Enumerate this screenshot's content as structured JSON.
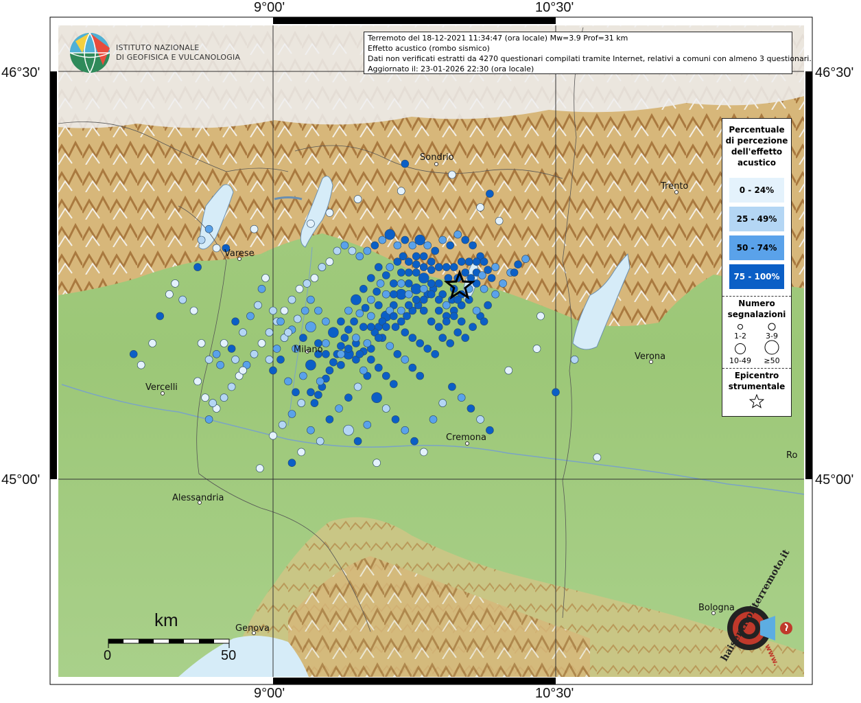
{
  "title_box": {
    "line1": "Terremoto del 18-12-2021 11:34:47 (ora locale) Mw=3.9 Prof=31 km",
    "line2": "Effetto acustico (rombo sismico)",
    "line3": "Dati non verificati estratti da 4270 questionari compilati tramite Internet, relativi a comuni con almeno 3 questionari.",
    "line4": "Aggiornato il: 23-01-2026 22:30 (ora locale)"
  },
  "logo": {
    "line1": "ISTITUTO NAZIONALE",
    "line2": "DI GEOFISICA E VULCANOLOGIA"
  },
  "coords": {
    "lon_left": "9°00'",
    "lon_right": "10°30'",
    "lat_top": "46°30'",
    "lat_bottom": "45°00'"
  },
  "legend": {
    "title": [
      "Percentuale",
      "di percezione",
      "dell'effetto",
      "acustico"
    ],
    "classes": [
      {
        "label": "0 - 24%",
        "color": "#e4f2fc"
      },
      {
        "label": "25 - 49%",
        "color": "#b4d6f4"
      },
      {
        "label": "50 - 74%",
        "color": "#5aa2ea"
      },
      {
        "label": "75 - 100%",
        "color": "#0b5fc6"
      }
    ],
    "count_title": [
      "Numero",
      "segnalazioni"
    ],
    "count_sizes": [
      "1-2",
      "3-9",
      "10-49",
      "≥50"
    ],
    "epicenter_title": [
      "Epicentro",
      "strumentale"
    ]
  },
  "cities": [
    "Sondrio",
    "Trento",
    "Varese",
    "Milano",
    "Verona",
    "Vercelli",
    "Cremona",
    "Alessandria",
    "Genova",
    "Bologna",
    "Ro"
  ],
  "scale": {
    "unit": "km",
    "zero": "0",
    "max": "50"
  },
  "watermark": {
    "text": "haisentitoilterremoto.it",
    "prefix": "www."
  },
  "colors": {
    "c1": "#e4f2fc",
    "c2": "#b4d6f4",
    "c3": "#5aa2ea",
    "c4": "#0b5fc6",
    "plain": "#9fc97c",
    "hills": "#d9b872",
    "mountains": "#b98a4f",
    "snow": "#f2f2f2",
    "water": "#d6ecf8"
  },
  "epicenter": {
    "lon": 9.99,
    "lat": 45.71
  },
  "map_extent": {
    "lon": [
      8.2,
      11.1
    ],
    "lat": [
      44.28,
      46.68
    ]
  },
  "points": [
    [
      9.93,
      45.74,
      4,
      2
    ],
    [
      9.88,
      45.72,
      4,
      2
    ],
    [
      9.85,
      45.7,
      4,
      2
    ],
    [
      9.82,
      45.68,
      4,
      2
    ],
    [
      9.8,
      45.66,
      4,
      2
    ],
    [
      9.77,
      45.64,
      4,
      2
    ],
    [
      9.74,
      45.62,
      4,
      2
    ],
    [
      9.71,
      45.6,
      4,
      2
    ],
    [
      9.68,
      45.58,
      4,
      2
    ],
    [
      9.65,
      45.56,
      4,
      2
    ],
    [
      9.9,
      45.68,
      4,
      2
    ],
    [
      9.95,
      45.66,
      4,
      2
    ],
    [
      9.98,
      45.74,
      4,
      2
    ],
    [
      10.02,
      45.76,
      4,
      2
    ],
    [
      10.05,
      45.74,
      4,
      2
    ],
    [
      10.08,
      45.76,
      4,
      2
    ],
    [
      10.11,
      45.75,
      3,
      2
    ],
    [
      10.14,
      45.77,
      4,
      2
    ],
    [
      9.96,
      45.78,
      4,
      2
    ],
    [
      9.92,
      45.78,
      4,
      2
    ],
    [
      9.88,
      45.78,
      4,
      2
    ],
    [
      9.84,
      45.77,
      4,
      2
    ],
    [
      9.8,
      45.78,
      4,
      2
    ],
    [
      9.76,
      45.79,
      4,
      2
    ],
    [
      9.72,
      45.8,
      4,
      2
    ],
    [
      9.69,
      45.82,
      4,
      2
    ],
    [
      9.66,
      45.8,
      4,
      2
    ],
    [
      9.62,
      45.78,
      3,
      2
    ],
    [
      9.6,
      45.75,
      4,
      2
    ],
    [
      9.57,
      45.72,
      3,
      2
    ],
    [
      9.55,
      45.69,
      4,
      2
    ],
    [
      9.52,
      45.66,
      3,
      2
    ],
    [
      9.49,
      45.63,
      4,
      2
    ],
    [
      9.46,
      45.61,
      3,
      2
    ],
    [
      9.43,
      45.58,
      4,
      2
    ],
    [
      9.4,
      45.55,
      4,
      2
    ],
    [
      9.38,
      45.52,
      4,
      2
    ],
    [
      9.36,
      45.49,
      4,
      2
    ],
    [
      9.34,
      45.46,
      4,
      2
    ],
    [
      9.32,
      45.43,
      4,
      2
    ],
    [
      9.3,
      45.4,
      4,
      2
    ],
    [
      9.28,
      45.37,
      4,
      2
    ],
    [
      9.26,
      45.34,
      4,
      2
    ],
    [
      9.24,
      45.31,
      4,
      2
    ],
    [
      9.22,
      45.28,
      4,
      2
    ],
    [
      9.28,
      45.58,
      3,
      2
    ],
    [
      9.24,
      45.62,
      3,
      2
    ],
    [
      9.2,
      45.66,
      3,
      2
    ],
    [
      9.17,
      45.62,
      3,
      2
    ],
    [
      9.13,
      45.59,
      2,
      2
    ],
    [
      9.1,
      45.55,
      3,
      2
    ],
    [
      9.06,
      45.52,
      2,
      2
    ],
    [
      9.02,
      45.48,
      3,
      2
    ],
    [
      8.98,
      45.44,
      2,
      2
    ],
    [
      9.44,
      45.5,
      4,
      2
    ],
    [
      9.48,
      45.47,
      4,
      2
    ],
    [
      9.52,
      45.44,
      4,
      2
    ],
    [
      9.56,
      45.41,
      4,
      2
    ],
    [
      9.6,
      45.38,
      4,
      2
    ],
    [
      9.64,
      45.35,
      4,
      2
    ],
    [
      9.58,
      45.52,
      4,
      2
    ],
    [
      9.62,
      45.49,
      3,
      2
    ],
    [
      9.66,
      45.46,
      4,
      2
    ],
    [
      9.7,
      45.44,
      3,
      2
    ],
    [
      9.74,
      45.41,
      4,
      2
    ],
    [
      9.78,
      45.38,
      4,
      2
    ],
    [
      9.7,
      45.54,
      4,
      2
    ],
    [
      9.74,
      45.52,
      4,
      2
    ],
    [
      9.78,
      45.5,
      4,
      2
    ],
    [
      9.82,
      45.48,
      4,
      2
    ],
    [
      9.86,
      45.46,
      4,
      2
    ],
    [
      9.9,
      45.52,
      4,
      2
    ],
    [
      9.94,
      45.5,
      4,
      2
    ],
    [
      9.98,
      45.54,
      4,
      2
    ],
    [
      10.02,
      45.52,
      4,
      2
    ],
    [
      10.06,
      45.56,
      4,
      2
    ],
    [
      10.1,
      45.6,
      4,
      2
    ],
    [
      10.14,
      45.64,
      4,
      2
    ],
    [
      10.18,
      45.68,
      3,
      2
    ],
    [
      10.22,
      45.72,
      3,
      2
    ],
    [
      10.26,
      45.76,
      3,
      2
    ],
    [
      10.3,
      45.79,
      4,
      2
    ],
    [
      10.34,
      45.81,
      3,
      2
    ],
    [
      10.1,
      45.82,
      4,
      2
    ],
    [
      10.06,
      45.86,
      4,
      2
    ],
    [
      10.02,
      45.88,
      4,
      2
    ],
    [
      9.98,
      45.9,
      3,
      2
    ],
    [
      9.94,
      45.86,
      4,
      2
    ],
    [
      9.9,
      45.88,
      3,
      2
    ],
    [
      9.86,
      45.84,
      4,
      2
    ],
    [
      9.82,
      45.86,
      3,
      2
    ],
    [
      9.78,
      45.88,
      4,
      3
    ],
    [
      9.74,
      45.86,
      3,
      2
    ],
    [
      9.7,
      45.88,
      4,
      2
    ],
    [
      9.66,
      45.86,
      3,
      2
    ],
    [
      9.62,
      45.9,
      4,
      3
    ],
    [
      9.58,
      45.88,
      3,
      2
    ],
    [
      9.54,
      45.86,
      4,
      2
    ],
    [
      9.5,
      45.84,
      3,
      2
    ],
    [
      9.46,
      45.82,
      3,
      2
    ],
    [
      9.42,
      45.84,
      2,
      2
    ],
    [
      9.38,
      45.86,
      3,
      2
    ],
    [
      9.34,
      45.84,
      2,
      2
    ],
    [
      9.3,
      45.8,
      1,
      2
    ],
    [
      9.26,
      45.78,
      2,
      2
    ],
    [
      9.22,
      45.74,
      1,
      2
    ],
    [
      9.18,
      45.72,
      2,
      2
    ],
    [
      9.14,
      45.7,
      1,
      2
    ],
    [
      9.1,
      45.66,
      2,
      2
    ],
    [
      9.06,
      45.62,
      1,
      2
    ],
    [
      9.02,
      45.58,
      2,
      2
    ],
    [
      8.98,
      45.54,
      2,
      2
    ],
    [
      8.94,
      45.5,
      1,
      2
    ],
    [
      8.9,
      45.46,
      2,
      2
    ],
    [
      8.86,
      45.42,
      3,
      2
    ],
    [
      8.82,
      45.38,
      1,
      2
    ],
    [
      8.78,
      45.34,
      2,
      2
    ],
    [
      8.74,
      45.3,
      2,
      2
    ],
    [
      8.7,
      45.26,
      1,
      2
    ],
    [
      8.66,
      45.22,
      3,
      2
    ],
    [
      9.0,
      45.16,
      1,
      2
    ],
    [
      9.05,
      45.2,
      2,
      2
    ],
    [
      9.1,
      45.24,
      3,
      2
    ],
    [
      9.15,
      45.28,
      2,
      2
    ],
    [
      9.2,
      45.32,
      4,
      2
    ],
    [
      9.25,
      45.36,
      3,
      2
    ],
    [
      9.3,
      45.22,
      4,
      2
    ],
    [
      9.35,
      45.26,
      3,
      2
    ],
    [
      9.4,
      45.3,
      4,
      2
    ],
    [
      9.45,
      45.34,
      2,
      2
    ],
    [
      9.5,
      45.38,
      4,
      2
    ],
    [
      9.55,
      45.3,
      4,
      3
    ],
    [
      9.6,
      45.26,
      2,
      2
    ],
    [
      9.65,
      45.22,
      4,
      2
    ],
    [
      9.7,
      45.18,
      3,
      2
    ],
    [
      9.75,
      45.14,
      4,
      2
    ],
    [
      9.8,
      45.1,
      1,
      2
    ],
    [
      9.85,
      45.22,
      3,
      2
    ],
    [
      9.9,
      45.28,
      2,
      2
    ],
    [
      9.95,
      45.34,
      4,
      2
    ],
    [
      10.0,
      45.3,
      3,
      2
    ],
    [
      10.05,
      45.26,
      4,
      2
    ],
    [
      10.1,
      45.22,
      2,
      2
    ],
    [
      10.15,
      45.18,
      4,
      2
    ],
    [
      9.4,
      45.18,
      2,
      3
    ],
    [
      9.45,
      45.14,
      4,
      2
    ],
    [
      9.5,
      45.2,
      3,
      2
    ],
    [
      9.2,
      45.18,
      3,
      2
    ],
    [
      9.25,
      45.14,
      2,
      2
    ],
    [
      9.15,
      45.1,
      1,
      2
    ],
    [
      8.93,
      45.04,
      1,
      2
    ],
    [
      9.1,
      45.06,
      4,
      2
    ],
    [
      9.55,
      45.06,
      1,
      2
    ],
    [
      10.42,
      45.6,
      1,
      2
    ],
    [
      10.4,
      45.48,
      1,
      2
    ],
    [
      10.25,
      45.4,
      1,
      2
    ],
    [
      10.5,
      45.32,
      4,
      2
    ],
    [
      10.6,
      45.44,
      2,
      2
    ],
    [
      10.72,
      45.08,
      1,
      2
    ],
    [
      10.28,
      45.76,
      4,
      2
    ],
    [
      10.2,
      45.95,
      1,
      2
    ],
    [
      10.1,
      46.0,
      1,
      2
    ],
    [
      10.15,
      46.05,
      4,
      2
    ],
    [
      9.7,
      46.16,
      4,
      2
    ],
    [
      9.95,
      46.12,
      1,
      2
    ],
    [
      9.68,
      46.06,
      1,
      2
    ],
    [
      9.45,
      46.03,
      1,
      2
    ],
    [
      9.3,
      45.98,
      1,
      2
    ],
    [
      9.2,
      45.94,
      1,
      2
    ],
    [
      8.9,
      45.92,
      1,
      2
    ],
    [
      8.75,
      45.85,
      4,
      2
    ],
    [
      8.6,
      45.78,
      4,
      2
    ],
    [
      8.48,
      45.72,
      1,
      2
    ],
    [
      8.45,
      45.68,
      1,
      2
    ],
    [
      8.4,
      45.6,
      4,
      2
    ],
    [
      8.36,
      45.5,
      1,
      2
    ],
    [
      8.3,
      45.42,
      1,
      2
    ],
    [
      8.26,
      45.46,
      4,
      2
    ],
    [
      8.62,
      45.88,
      2,
      2
    ],
    [
      8.66,
      45.92,
      3,
      2
    ],
    [
      8.7,
      45.85,
      1,
      2
    ],
    [
      8.58,
      45.62,
      1,
      2
    ],
    [
      8.52,
      45.66,
      2,
      2
    ],
    [
      8.8,
      45.58,
      4,
      2
    ],
    [
      8.84,
      45.54,
      2,
      2
    ],
    [
      8.88,
      45.6,
      3,
      2
    ],
    [
      8.92,
      45.64,
      2,
      2
    ],
    [
      8.94,
      45.7,
      3,
      2
    ],
    [
      8.96,
      45.74,
      1,
      2
    ],
    [
      8.74,
      45.5,
      1,
      2
    ],
    [
      8.78,
      45.48,
      4,
      2
    ],
    [
      8.7,
      45.46,
      3,
      2
    ],
    [
      8.62,
      45.5,
      1,
      2
    ],
    [
      8.66,
      45.44,
      2,
      2
    ],
    [
      8.72,
      45.42,
      3,
      2
    ],
    [
      8.8,
      45.44,
      2,
      2
    ],
    [
      8.84,
      45.4,
      1,
      2
    ],
    [
      8.6,
      45.36,
      1,
      2
    ],
    [
      8.64,
      45.3,
      1,
      2
    ],
    [
      8.68,
      45.28,
      2,
      2
    ],
    [
      9.0,
      45.4,
      4,
      2
    ],
    [
      9.04,
      45.44,
      4,
      2
    ],
    [
      9.08,
      45.36,
      3,
      2
    ],
    [
      9.12,
      45.32,
      4,
      2
    ],
    [
      9.16,
      45.38,
      3,
      2
    ],
    [
      9.2,
      45.42,
      4,
      3
    ],
    [
      9.24,
      45.46,
      4,
      2
    ],
    [
      9.28,
      45.5,
      3,
      2
    ],
    [
      9.32,
      45.54,
      4,
      3
    ],
    [
      9.36,
      45.58,
      4,
      2
    ],
    [
      9.4,
      45.62,
      3,
      2
    ],
    [
      9.44,
      45.66,
      4,
      3
    ],
    [
      9.48,
      45.7,
      4,
      2
    ],
    [
      9.52,
      45.74,
      4,
      2
    ],
    [
      9.56,
      45.78,
      4,
      2
    ],
    [
      9.12,
      45.48,
      3,
      2
    ],
    [
      9.16,
      45.52,
      4,
      2
    ],
    [
      9.2,
      45.56,
      3,
      3
    ],
    [
      9.24,
      45.5,
      4,
      2
    ],
    [
      9.28,
      45.46,
      4,
      2
    ],
    [
      9.08,
      45.54,
      2,
      2
    ],
    [
      9.04,
      45.58,
      3,
      2
    ],
    [
      9.0,
      45.62,
      2,
      2
    ],
    [
      9.36,
      45.42,
      4,
      2
    ],
    [
      9.4,
      45.46,
      4,
      3
    ],
    [
      9.44,
      45.44,
      4,
      2
    ],
    [
      9.48,
      45.4,
      3,
      2
    ],
    [
      9.52,
      45.48,
      4,
      2
    ],
    [
      9.56,
      45.56,
      4,
      2
    ],
    [
      9.6,
      45.6,
      4,
      3
    ],
    [
      9.64,
      45.64,
      4,
      2
    ],
    [
      9.68,
      45.68,
      4,
      3
    ],
    [
      9.72,
      45.72,
      4,
      2
    ],
    [
      9.76,
      45.76,
      4,
      2
    ],
    [
      9.8,
      45.74,
      4,
      3
    ],
    [
      9.84,
      45.72,
      4,
      2
    ],
    [
      9.88,
      45.62,
      4,
      2
    ],
    [
      9.92,
      45.6,
      4,
      2
    ],
    [
      9.96,
      45.62,
      4,
      2
    ],
    [
      10.0,
      45.64,
      4,
      2
    ],
    [
      9.6,
      45.68,
      3,
      2
    ],
    [
      9.64,
      45.72,
      4,
      2
    ],
    [
      9.68,
      45.76,
      4,
      2
    ],
    [
      9.72,
      45.68,
      3,
      2
    ],
    [
      9.76,
      45.7,
      4,
      3
    ],
    [
      9.8,
      45.62,
      4,
      2
    ],
    [
      9.84,
      45.58,
      4,
      2
    ],
    [
      9.88,
      45.56,
      4,
      2
    ],
    [
      9.92,
      45.58,
      4,
      2
    ],
    [
      9.96,
      45.7,
      4,
      2
    ],
    [
      10.0,
      45.68,
      4,
      2
    ],
    [
      10.04,
      45.7,
      3,
      2
    ],
    [
      10.08,
      45.72,
      4,
      2
    ],
    [
      10.12,
      45.7,
      3,
      2
    ],
    [
      10.04,
      45.8,
      4,
      2
    ],
    [
      10.08,
      45.8,
      4,
      2
    ],
    [
      10.12,
      45.8,
      4,
      2
    ],
    [
      10.0,
      45.8,
      4,
      2
    ],
    [
      9.84,
      45.8,
      4,
      2
    ],
    [
      9.8,
      45.82,
      4,
      2
    ],
    [
      9.76,
      45.82,
      4,
      2
    ],
    [
      9.72,
      45.76,
      4,
      2
    ],
    [
      9.68,
      45.72,
      3,
      2
    ],
    [
      9.64,
      45.68,
      4,
      2
    ],
    [
      9.56,
      45.64,
      4,
      2
    ],
    [
      9.52,
      45.6,
      3,
      2
    ],
    [
      9.48,
      45.56,
      4,
      2
    ],
    [
      9.44,
      45.52,
      3,
      2
    ],
    [
      9.4,
      45.48,
      4,
      2
    ],
    [
      9.36,
      45.46,
      3,
      2
    ],
    [
      9.62,
      45.62,
      3,
      2
    ],
    [
      9.58,
      45.58,
      4,
      2
    ],
    [
      9.54,
      45.54,
      4,
      2
    ],
    [
      9.5,
      45.5,
      3,
      2
    ],
    [
      9.46,
      45.46,
      4,
      2
    ],
    [
      9.76,
      45.66,
      4,
      2
    ],
    [
      9.72,
      45.64,
      4,
      2
    ],
    [
      9.68,
      45.62,
      3,
      2
    ],
    [
      9.64,
      45.6,
      4,
      2
    ],
    [
      9.6,
      45.56,
      4,
      2
    ],
    [
      9.56,
      45.52,
      4,
      2
    ],
    [
      9.52,
      45.56,
      4,
      2
    ],
    [
      9.8,
      45.7,
      3,
      2
    ],
    [
      9.84,
      45.68,
      4,
      2
    ],
    [
      9.88,
      45.66,
      4,
      2
    ],
    [
      9.92,
      45.64,
      3,
      2
    ],
    [
      9.96,
      45.6,
      4,
      2
    ],
    [
      10.0,
      45.58,
      4,
      2
    ],
    [
      9.98,
      45.66,
      4,
      2
    ],
    [
      10.04,
      45.66,
      4,
      2
    ],
    [
      10.08,
      45.62,
      3,
      2
    ],
    [
      10.12,
      45.58,
      4,
      2
    ],
    [
      10.16,
      45.74,
      4,
      2
    ],
    [
      10.18,
      45.78,
      3,
      2
    ]
  ]
}
